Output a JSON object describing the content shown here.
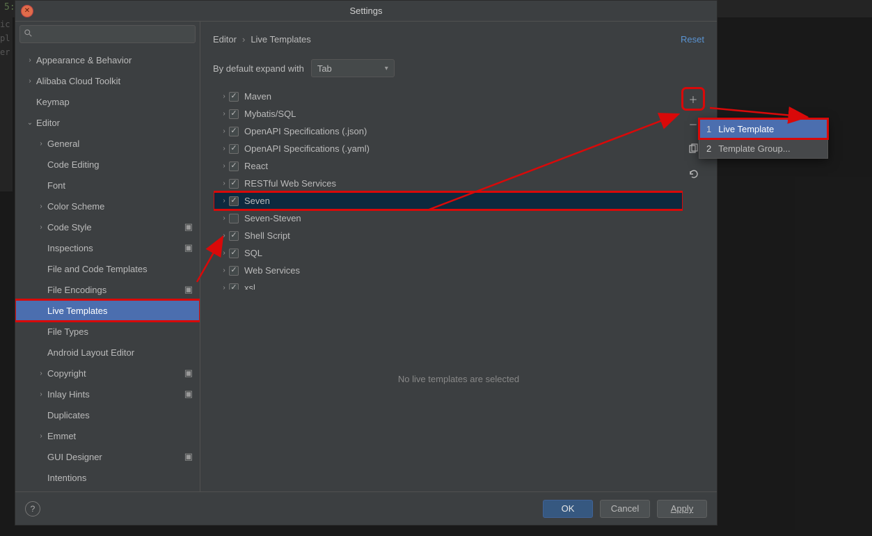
{
  "dialog": {
    "title": "Settings",
    "search_placeholder": ""
  },
  "breadcrumb": {
    "root": "Editor",
    "leaf": "Live Templates",
    "reset": "Reset"
  },
  "expand": {
    "label": "By default expand with",
    "value": "Tab"
  },
  "tree": [
    {
      "label": "Appearance & Behavior",
      "level": 0,
      "expand": "›"
    },
    {
      "label": "Alibaba Cloud Toolkit",
      "level": 0,
      "expand": "›"
    },
    {
      "label": "Keymap",
      "level": 0,
      "expand": ""
    },
    {
      "label": "Editor",
      "level": 0,
      "expand": "⌄"
    },
    {
      "label": "General",
      "level": 1,
      "expand": "›"
    },
    {
      "label": "Code Editing",
      "level": 1,
      "expand": ""
    },
    {
      "label": "Font",
      "level": 1,
      "expand": ""
    },
    {
      "label": "Color Scheme",
      "level": 1,
      "expand": "›"
    },
    {
      "label": "Code Style",
      "level": 1,
      "expand": "›",
      "gear": true
    },
    {
      "label": "Inspections",
      "level": 1,
      "expand": "",
      "gear": true
    },
    {
      "label": "File and Code Templates",
      "level": 1,
      "expand": ""
    },
    {
      "label": "File Encodings",
      "level": 1,
      "expand": "",
      "gear": true
    },
    {
      "label": "Live Templates",
      "level": 1,
      "expand": "",
      "selected": true,
      "boxed": true
    },
    {
      "label": "File Types",
      "level": 1,
      "expand": ""
    },
    {
      "label": "Android Layout Editor",
      "level": 1,
      "expand": ""
    },
    {
      "label": "Copyright",
      "level": 1,
      "expand": "›",
      "gear": true
    },
    {
      "label": "Inlay Hints",
      "level": 1,
      "expand": "›",
      "gear": true
    },
    {
      "label": "Duplicates",
      "level": 1,
      "expand": ""
    },
    {
      "label": "Emmet",
      "level": 1,
      "expand": "›"
    },
    {
      "label": "GUI Designer",
      "level": 1,
      "expand": "",
      "gear": true
    },
    {
      "label": "Intentions",
      "level": 1,
      "expand": ""
    }
  ],
  "groups": [
    {
      "label": "Maven",
      "checked": true
    },
    {
      "label": "Mybatis/SQL",
      "checked": true
    },
    {
      "label": "OpenAPI Specifications (.json)",
      "checked": true
    },
    {
      "label": "OpenAPI Specifications (.yaml)",
      "checked": true
    },
    {
      "label": "React",
      "checked": true
    },
    {
      "label": "RESTful Web Services",
      "checked": true
    },
    {
      "label": "Seven",
      "checked": true,
      "selected": true,
      "boxed": true
    },
    {
      "label": "Seven-Steven",
      "checked": false
    },
    {
      "label": "Shell Script",
      "checked": true
    },
    {
      "label": "SQL",
      "checked": true
    },
    {
      "label": "Web Services",
      "checked": true
    },
    {
      "label": "xsl",
      "checked": true
    }
  ],
  "no_selection": "No live templates are selected",
  "popup": [
    {
      "num": "1",
      "label": "Live Template",
      "hl": true
    },
    {
      "num": "2",
      "label": "Template Group...",
      "hl": false
    }
  ],
  "buttons": {
    "ok": "OK",
    "cancel": "Cancel",
    "apply": "Apply",
    "help": "?"
  },
  "bg_line": "5:"
}
